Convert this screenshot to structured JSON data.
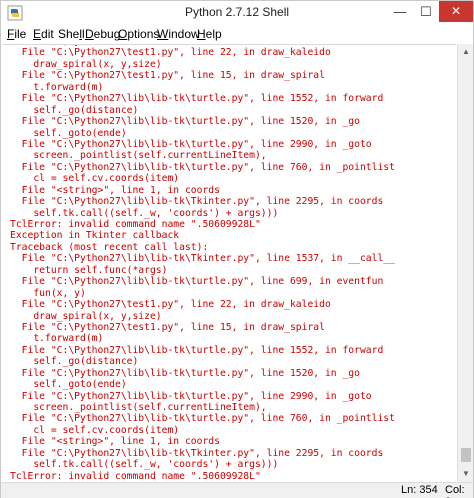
{
  "window": {
    "title": "Python 2.7.12 Shell",
    "controls": {
      "minimize": "—",
      "maximize": "☐",
      "close": "✕"
    }
  },
  "menu": [
    {
      "pre": "",
      "ul": "F",
      "post": "ile"
    },
    {
      "pre": "",
      "ul": "E",
      "post": "dit"
    },
    {
      "pre": "She",
      "ul": "l",
      "post": "l"
    },
    {
      "pre": "",
      "ul": "D",
      "post": "ebug"
    },
    {
      "pre": "",
      "ul": "O",
      "post": "ptions"
    },
    {
      "pre": "",
      "ul": "W",
      "post": "indow"
    },
    {
      "pre": "",
      "ul": "H",
      "post": "elp"
    }
  ],
  "shell": {
    "lines": [
      {
        "t": "    fun(x, y)",
        "c": "err"
      },
      {
        "t": "  File \"C:\\Python27\\test1.py\", line 22, in draw_kaleido",
        "c": "err"
      },
      {
        "t": "    draw_spiral(x, y,size)",
        "c": "err"
      },
      {
        "t": "  File \"C:\\Python27\\test1.py\", line 15, in draw_spiral",
        "c": "err"
      },
      {
        "t": "    t.forward(m)",
        "c": "err"
      },
      {
        "t": "  File \"C:\\Python27\\lib\\lib-tk\\turtle.py\", line 1552, in forward",
        "c": "err"
      },
      {
        "t": "    self._go(distance)",
        "c": "err"
      },
      {
        "t": "  File \"C:\\Python27\\lib\\lib-tk\\turtle.py\", line 1520, in _go",
        "c": "err"
      },
      {
        "t": "    self._goto(ende)",
        "c": "err"
      },
      {
        "t": "  File \"C:\\Python27\\lib\\lib-tk\\turtle.py\", line 2990, in _goto",
        "c": "err"
      },
      {
        "t": "    screen._pointlist(self.currentLineItem),",
        "c": "err"
      },
      {
        "t": "  File \"C:\\Python27\\lib\\lib-tk\\turtle.py\", line 760, in _pointlist",
        "c": "err"
      },
      {
        "t": "    cl = self.cv.coords(item)",
        "c": "err"
      },
      {
        "t": "  File \"<string>\", line 1, in coords",
        "c": "err"
      },
      {
        "t": "  File \"C:\\Python27\\lib\\lib-tk\\Tkinter.py\", line 2295, in coords",
        "c": "err"
      },
      {
        "t": "    self.tk.call((self._w, 'coords') + args)))",
        "c": "err"
      },
      {
        "t": "TclError: invalid command name \".50609928L\"",
        "c": "err"
      },
      {
        "t": "Exception in Tkinter callback",
        "c": "err"
      },
      {
        "t": "Traceback (most recent call last):",
        "c": "err"
      },
      {
        "t": "  File \"C:\\Python27\\lib\\lib-tk\\Tkinter.py\", line 1537, in __call__",
        "c": "err"
      },
      {
        "t": "    return self.func(*args)",
        "c": "err"
      },
      {
        "t": "  File \"C:\\Python27\\lib\\lib-tk\\turtle.py\", line 699, in eventfun",
        "c": "err"
      },
      {
        "t": "    fun(x, y)",
        "c": "err"
      },
      {
        "t": "  File \"C:\\Python27\\test1.py\", line 22, in draw_kaleido",
        "c": "err"
      },
      {
        "t": "    draw_spiral(x, y,size)",
        "c": "err"
      },
      {
        "t": "  File \"C:\\Python27\\test1.py\", line 15, in draw_spiral",
        "c": "err"
      },
      {
        "t": "    t.forward(m)",
        "c": "err"
      },
      {
        "t": "  File \"C:\\Python27\\lib\\lib-tk\\turtle.py\", line 1552, in forward",
        "c": "err"
      },
      {
        "t": "    self._go(distance)",
        "c": "err"
      },
      {
        "t": "  File \"C:\\Python27\\lib\\lib-tk\\turtle.py\", line 1520, in _go",
        "c": "err"
      },
      {
        "t": "    self._goto(ende)",
        "c": "err"
      },
      {
        "t": "  File \"C:\\Python27\\lib\\lib-tk\\turtle.py\", line 2990, in _goto",
        "c": "err"
      },
      {
        "t": "    screen._pointlist(self.currentLineItem),",
        "c": "err"
      },
      {
        "t": "  File \"C:\\Python27\\lib\\lib-tk\\turtle.py\", line 760, in _pointlist",
        "c": "err"
      },
      {
        "t": "    cl = self.cv.coords(item)",
        "c": "err"
      },
      {
        "t": "  File \"<string>\", line 1, in coords",
        "c": "err"
      },
      {
        "t": "  File \"C:\\Python27\\lib\\lib-tk\\Tkinter.py\", line 2295, in coords",
        "c": "err"
      },
      {
        "t": "    self.tk.call((self._w, 'coords') + args)))",
        "c": "err"
      },
      {
        "t": "TclError: invalid command name \".50609928L\"",
        "c": "err"
      },
      {
        "t": ">>> ",
        "c": "prompt"
      }
    ]
  },
  "status": {
    "line": "Ln: 354",
    "col": "Col: 0"
  },
  "colors": {
    "error_text": "#cc0000",
    "prompt": "#7a3a00",
    "close_button": "#c7372f"
  },
  "icons": {
    "app": "python-idle-icon",
    "scroll_up": "arrow-up-icon",
    "scroll_down": "arrow-down-icon"
  }
}
